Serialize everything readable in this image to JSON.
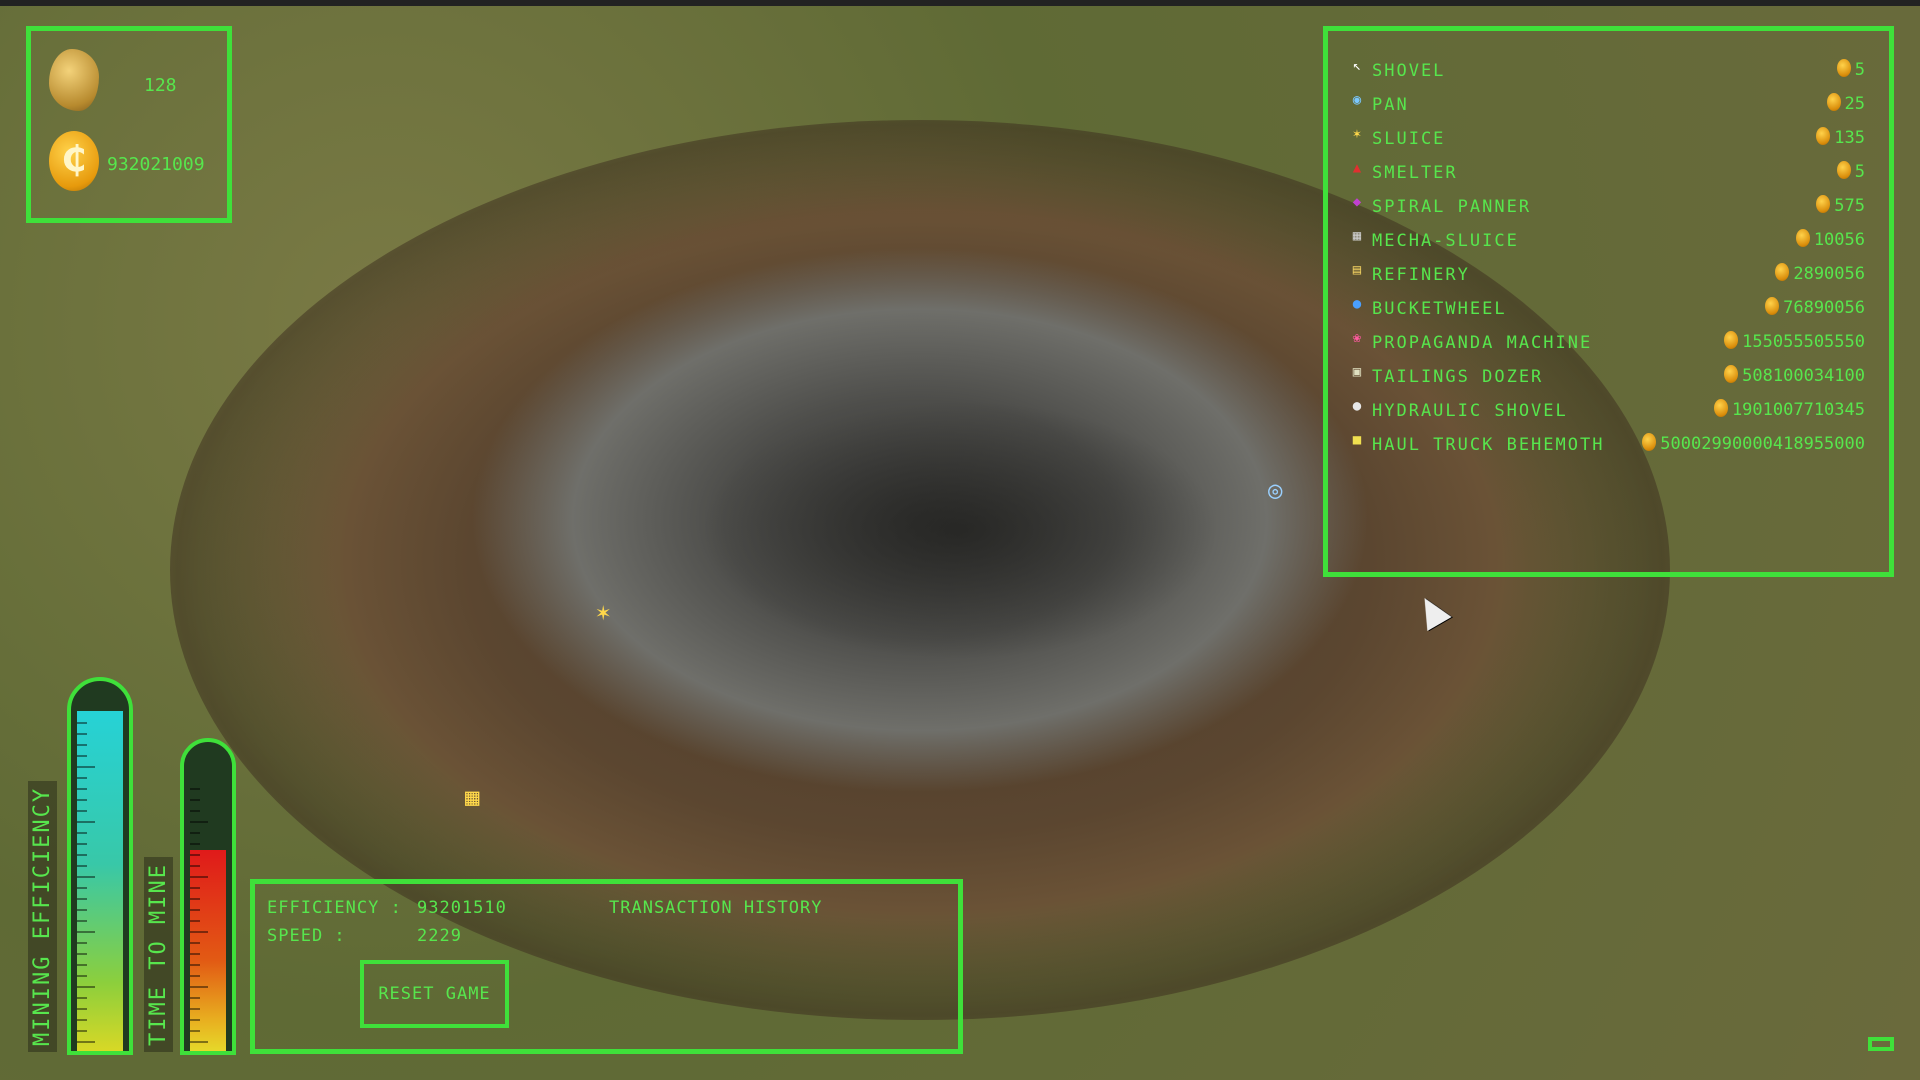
{
  "resources": {
    "gold_nuggets": "128",
    "coins": "932021009",
    "coin_symbol": "₵"
  },
  "shop": {
    "items": [
      {
        "name": "SHOVEL",
        "cost": "5",
        "icon": "pointer-icon"
      },
      {
        "name": "PAN",
        "cost": "25",
        "icon": "pan-icon"
      },
      {
        "name": "SLUICE",
        "cost": "135",
        "icon": "sluice-icon"
      },
      {
        "name": "SMELTER",
        "cost": "5",
        "icon": "smelter-icon"
      },
      {
        "name": "SPIRAL PANNER",
        "cost": "575",
        "icon": "spiral-panner-icon"
      },
      {
        "name": "MECHA-SLUICE",
        "cost": "10056",
        "icon": "mecha-sluice-icon"
      },
      {
        "name": "REFINERY",
        "cost": "2890056",
        "icon": "refinery-icon"
      },
      {
        "name": "BUCKETWHEEL",
        "cost": "76890056",
        "icon": "bucketwheel-icon"
      },
      {
        "name": "PROPAGANDA MACHINE",
        "cost": "155055505550",
        "icon": "propaganda-icon"
      },
      {
        "name": "TAILINGS DOZER",
        "cost": "508100034100",
        "icon": "dozer-icon"
      },
      {
        "name": "HYDRAULIC SHOVEL",
        "cost": "1901007710345",
        "icon": "hydraulic-shovel-icon"
      },
      {
        "name": "HAUL TRUCK BEHEMOTH",
        "cost": "50002990000418955000",
        "icon": "haul-truck-icon"
      }
    ]
  },
  "gauges": {
    "mining_efficiency_label": "MINING EFFICIENCY",
    "mining_efficiency_level": 0.92,
    "time_to_mine_label": "TIME TO MINE",
    "time_to_mine_level": 0.65
  },
  "stats": {
    "efficiency_label": "EFFICIENCY :",
    "efficiency_value": "93201510",
    "speed_label": "SPEED :",
    "speed_value": "2229",
    "transaction_history_label": "TRANSACTION HISTORY",
    "reset_label": "RESET GAME"
  },
  "colors": {
    "hud_green": "#3fe03a",
    "text_green": "#57e64d"
  }
}
